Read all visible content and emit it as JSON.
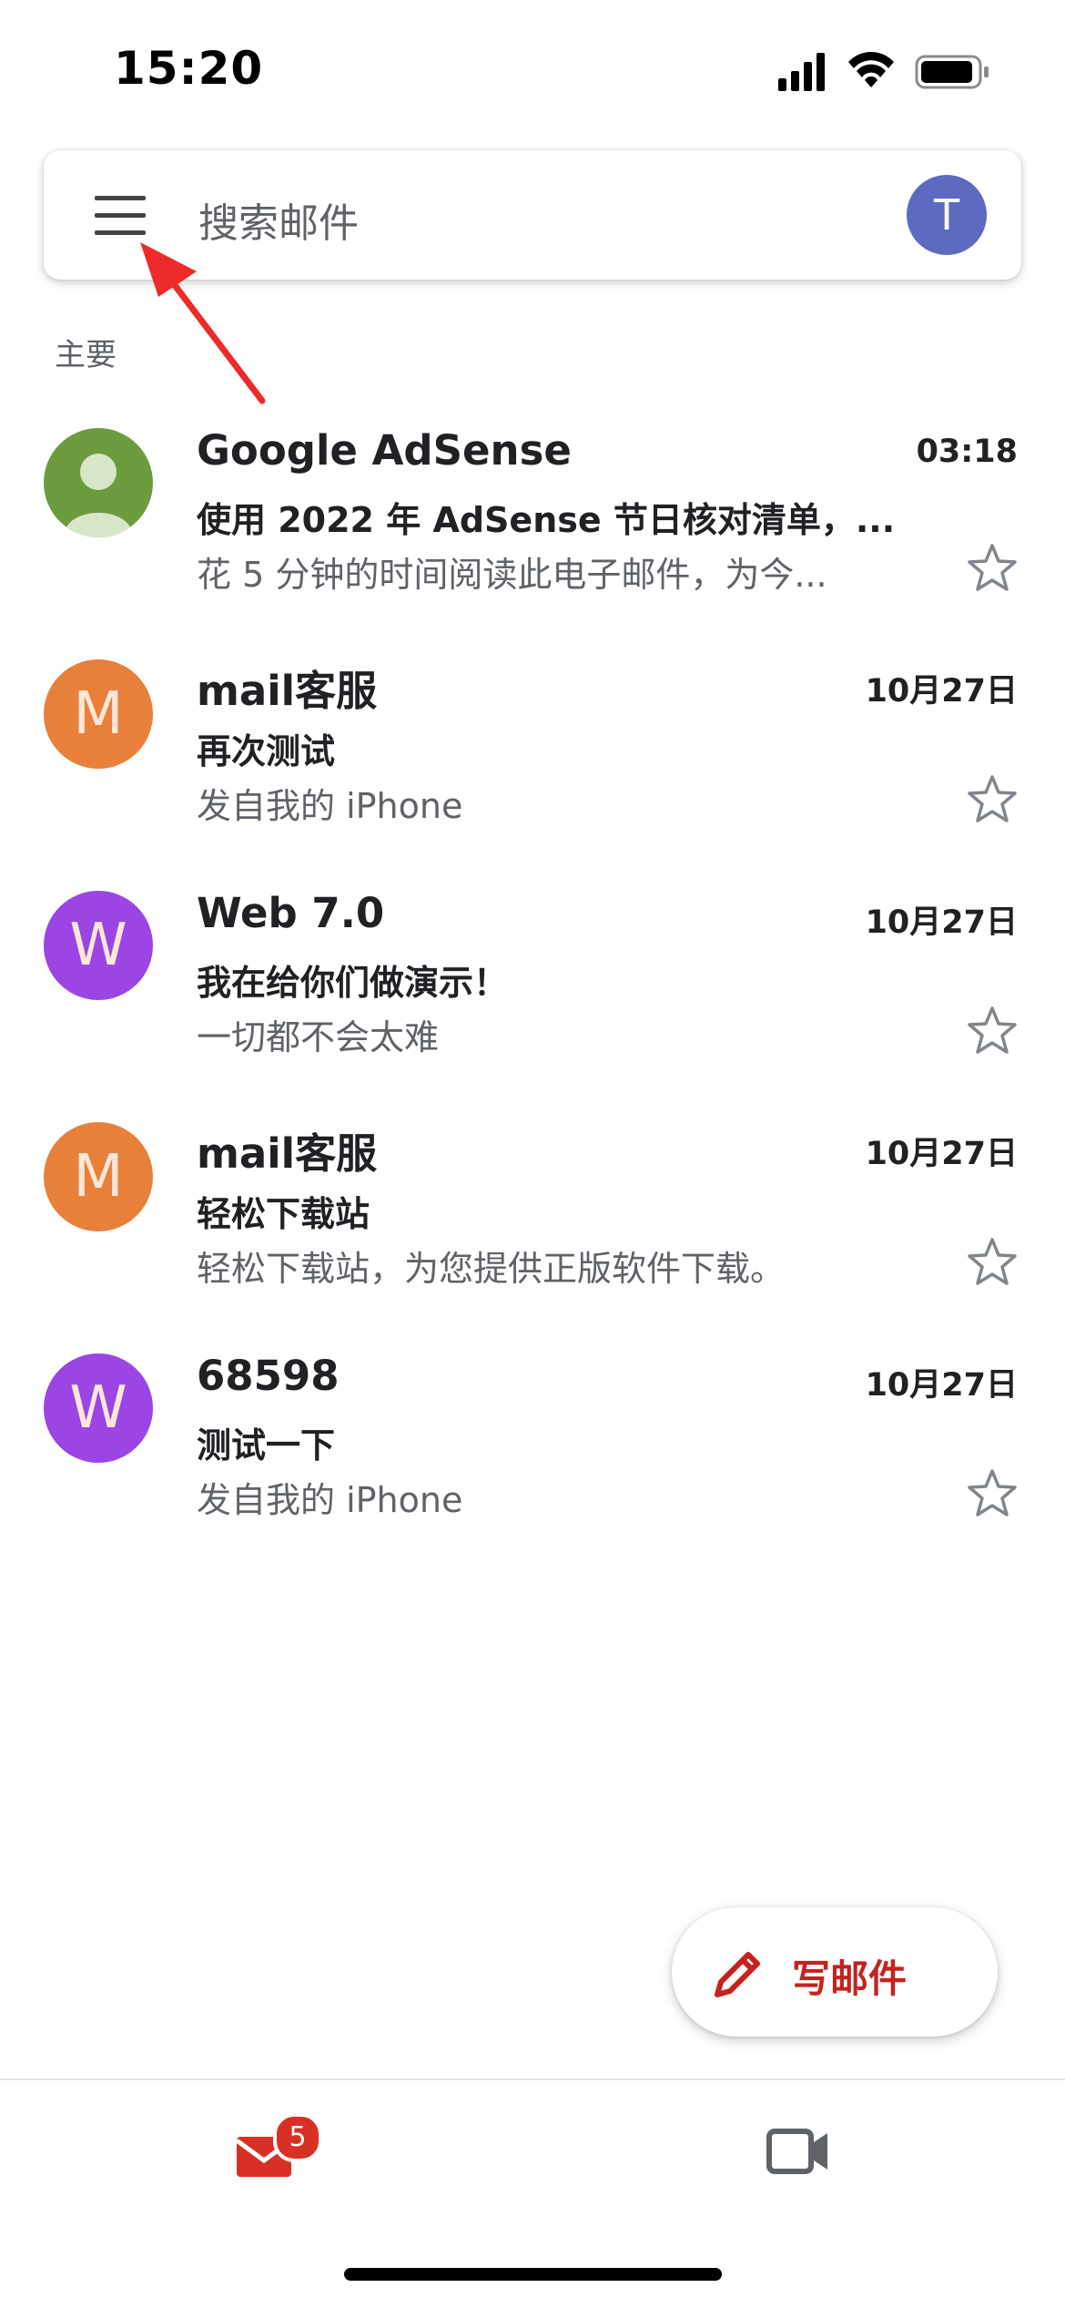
{
  "status_bar": {
    "time": "15:20"
  },
  "search": {
    "placeholder": "搜索邮件",
    "account_initial": "T",
    "account_color": "#5c6bc0"
  },
  "section_label": "主要",
  "mails": [
    {
      "sender": "Google AdSense",
      "date": "03:18",
      "subject": "使用 2022 年 AdSense 节日核对清单，...",
      "snippet": "花 5 分钟的时间阅读此电子邮件，为今...",
      "avatar": "",
      "avatar_type": "person-icon",
      "avatar_color": "#6d9c3e"
    },
    {
      "sender": "mail客服",
      "date": "10月27日",
      "subject": "再次测试",
      "snippet": "发自我的 iPhone",
      "avatar": "M",
      "avatar_type": "letter",
      "avatar_color": "#e8803a"
    },
    {
      "sender": "Web 7.0",
      "date": "10月27日",
      "subject": "我在给你们做演示！",
      "snippet": "一切都不会太难",
      "avatar": "W",
      "avatar_type": "letter",
      "avatar_color": "#9b45e4"
    },
    {
      "sender": "mail客服",
      "date": "10月27日",
      "subject": "轻松下载站",
      "snippet": "轻松下载站，为您提供正版软件下载。",
      "avatar": "M",
      "avatar_type": "letter",
      "avatar_color": "#e8803a"
    },
    {
      "sender": "68598",
      "date": "10月27日",
      "subject": "测试一下",
      "snippet": "发自我的 iPhone",
      "avatar": "W",
      "avatar_type": "letter",
      "avatar_color": "#9b45e4"
    }
  ],
  "compose": {
    "label": "写邮件",
    "color": "#c5221f"
  },
  "bottom_nav": {
    "mail_badge": "5",
    "mail_icon": "mail-icon",
    "meet_icon": "video-camera-icon"
  }
}
